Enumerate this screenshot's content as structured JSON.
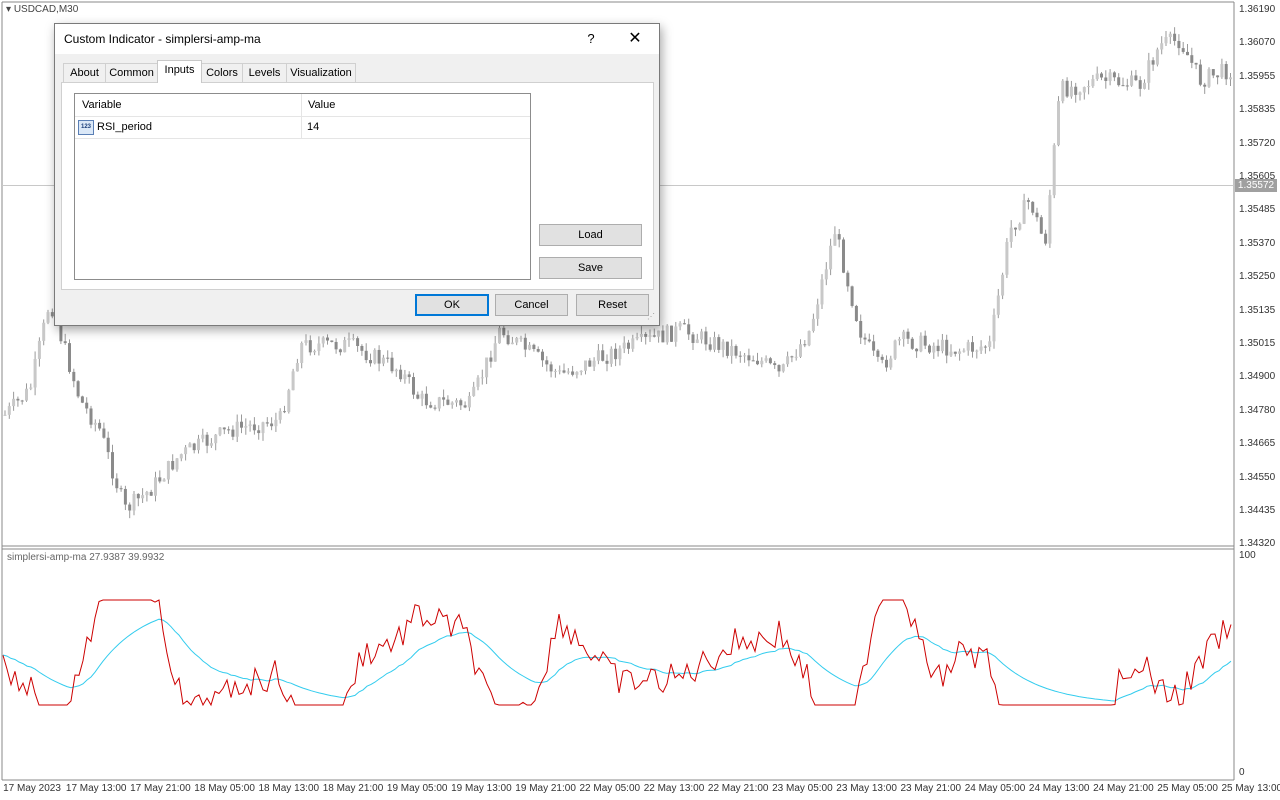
{
  "chart": {
    "symbol": "USDCAD,M30",
    "current_price": "1.35572",
    "price_axis": [
      "1.36190",
      "1.36070",
      "1.35955",
      "1.35835",
      "1.35720",
      "1.35605",
      "1.35485",
      "1.35370",
      "1.35250",
      "1.35135",
      "1.35015",
      "1.34900",
      "1.34780",
      "1.34665",
      "1.34550",
      "1.34435",
      "1.34320"
    ],
    "time_axis": [
      "17 May 2023",
      "17 May 13:00",
      "17 May 21:00",
      "18 May 05:00",
      "18 May 13:00",
      "18 May 21:00",
      "19 May 05:00",
      "19 May 13:00",
      "19 May 21:00",
      "22 May 05:00",
      "22 May 13:00",
      "22 May 21:00",
      "23 May 05:00",
      "23 May 13:00",
      "23 May 21:00",
      "24 May 05:00",
      "24 May 13:00",
      "24 May 21:00",
      "25 May 05:00",
      "25 May 13:00"
    ],
    "indicator_label": "simplersi-amp-ma 27.9387 39.9932",
    "indicator_scale_top": "100",
    "indicator_scale_bottom": "0",
    "colors": {
      "candle": "#9a9a9a",
      "rsi_line": "#cc0000",
      "ma_line": "#33ccee",
      "grid": "#c8c8c8"
    }
  },
  "dialog": {
    "title": "Custom Indicator - simplersi-amp-ma",
    "help": "?",
    "close": "✕",
    "tabs": [
      "About",
      "Common",
      "Inputs",
      "Colors",
      "Levels",
      "Visualization"
    ],
    "active_tab": "Inputs",
    "table": {
      "headers": [
        "Variable",
        "Value"
      ],
      "rows": [
        {
          "icon": "123",
          "variable": "RSI_period",
          "value": "14"
        }
      ]
    },
    "buttons": {
      "load": "Load",
      "save": "Save",
      "ok": "OK",
      "cancel": "Cancel",
      "reset": "Reset"
    }
  }
}
